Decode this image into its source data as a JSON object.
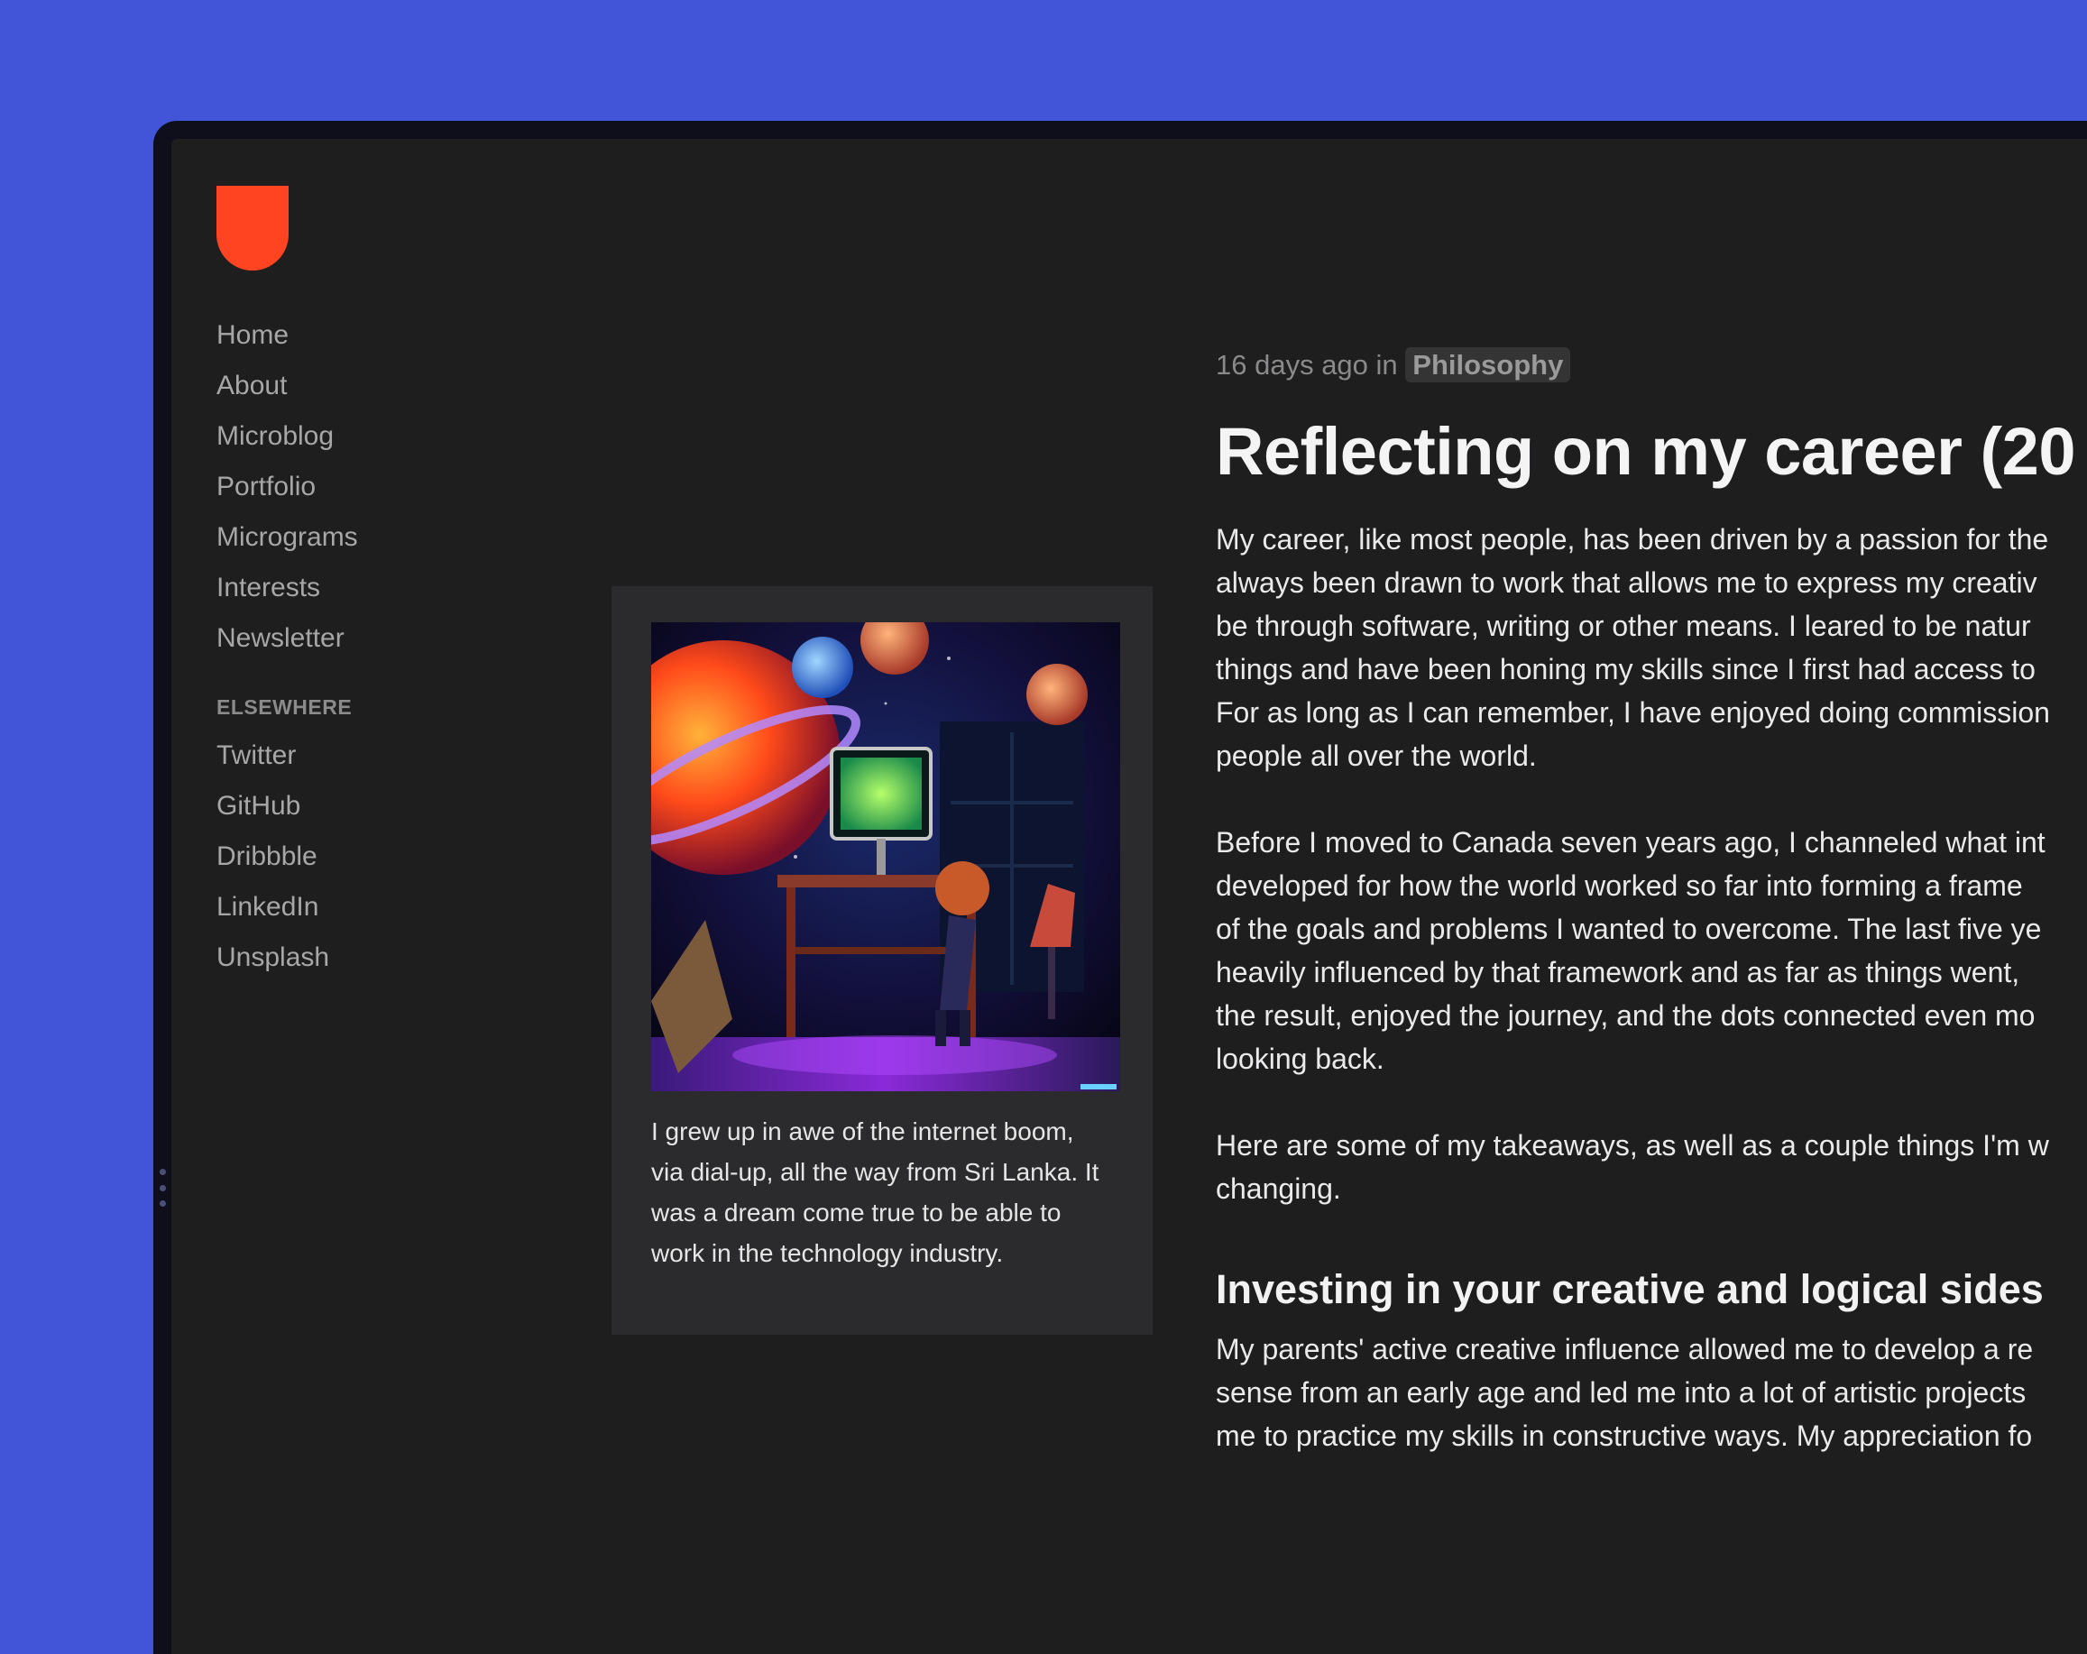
{
  "nav": {
    "items": [
      "Home",
      "About",
      "Microblog",
      "Portfolio",
      "Micrograms",
      "Interests",
      "Newsletter"
    ],
    "elsewhere_label": "ELSEWHERE",
    "elsewhere": [
      "Twitter",
      "GitHub",
      "Dribbble",
      "LinkedIn",
      "Unsplash"
    ]
  },
  "figure": {
    "caption": "I grew up in awe of the internet boom,\nvia dial-up, all the way from Sri Lanka. It\nwas a dream come true to be able to\nwork in the technology industry."
  },
  "article": {
    "meta_prefix": "16 days ago in",
    "category": "Philosophy",
    "title": "Reflecting on my career (20",
    "p1": "My career, like most people, has been driven by a passion for the\nalways been drawn to work that allows me to express my creativ\nbe through software, writing or other means. I leared to be natur\nthings and have been honing my skills since I first had access to\nFor as long as I can remember, I have enjoyed doing commission\npeople all over the world.",
    "p2": "Before I moved to Canada seven years ago, I channeled what int\ndeveloped for how the world worked so far into forming a frame\nof the goals and problems I wanted to overcome. The last five ye\nheavily influenced by that framework and as far as things went,\nthe result, enjoyed the journey, and the dots connected even mo\nlooking back.",
    "p3": "Here are some of my takeaways, as well as a couple things I'm w\nchanging.",
    "subhead": "Investing in your creative and logical sides",
    "p4": "My parents' active creative influence allowed me to develop a re\nsense from an early age and led me into a lot of artistic projects\nme to practice my skills in constructive ways. My appreciation fo"
  },
  "colors": {
    "background": "#4254d8",
    "window": "#1e1e1f",
    "logo": "#ff4421",
    "figure_bg": "#2b2b2d"
  }
}
